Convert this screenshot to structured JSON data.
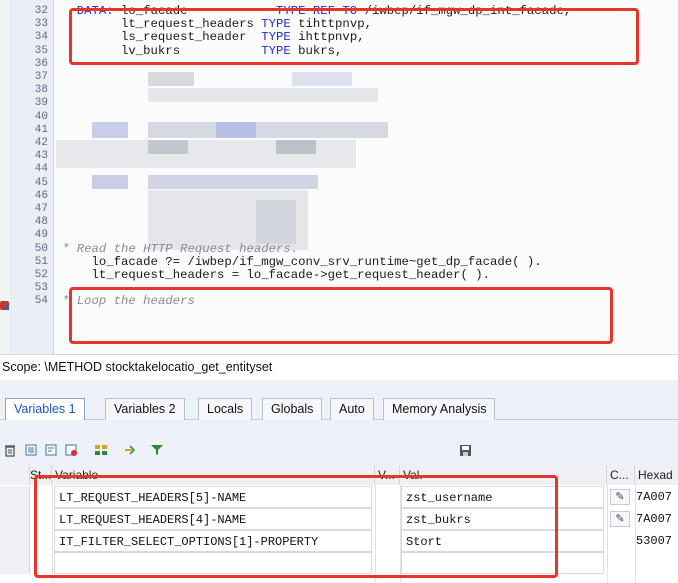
{
  "editor": {
    "line_numbers": [
      "32",
      "33",
      "34",
      "35",
      "36",
      "37",
      "38",
      "39",
      "40",
      "41",
      "42",
      "43",
      "44",
      "45",
      "46",
      "47",
      "48",
      "49",
      "50",
      "51",
      "52",
      "53",
      "54"
    ],
    "code_lines": [
      {
        "parts": [
          {
            "t": "  DATA: ",
            "c": "kw"
          },
          {
            "t": "lo_facade            ",
            "c": ""
          },
          {
            "t": "TYPE REF TO",
            "c": "kw"
          },
          {
            "t": " /iwbep/if_mgw_dp_int_facade,",
            "c": ""
          }
        ]
      },
      {
        "parts": [
          {
            "t": "        lt_request_headers ",
            "c": ""
          },
          {
            "t": "TYPE",
            "c": "kw"
          },
          {
            "t": " tihttpnvp,",
            "c": ""
          }
        ]
      },
      {
        "parts": [
          {
            "t": "        ls_request_header  ",
            "c": ""
          },
          {
            "t": "TYPE",
            "c": "kw"
          },
          {
            "t": " ihttpnvp,",
            "c": ""
          }
        ]
      },
      {
        "parts": [
          {
            "t": "        lv_bukrs           ",
            "c": ""
          },
          {
            "t": "TYPE",
            "c": "kw"
          },
          {
            "t": " bukrs,",
            "c": ""
          }
        ]
      },
      {
        "parts": [
          {
            "t": "* Read the HTTP Request headers.",
            "c": "cm"
          }
        ]
      },
      {
        "parts": [
          {
            "t": "    lo_facade ?= /iwbep/if_mgw_conv_srv_runtime~get_dp_facade( ).",
            "c": ""
          }
        ]
      },
      {
        "parts": [
          {
            "t": "    lt_request_headers = lo_facade->get_request_header( ).",
            "c": ""
          }
        ]
      },
      {
        "parts": [
          {
            "t": "* ",
            "c": "cm"
          },
          {
            "t": "Loop the headers",
            "c": "cm"
          }
        ]
      }
    ]
  },
  "scope": {
    "label": "Scope: \\METHOD stocktakelocatio_get_entityset"
  },
  "tabs": [
    {
      "label": "Variables 1",
      "active": true
    },
    {
      "label": "Variables 2",
      "active": false
    },
    {
      "label": "Locals",
      "active": false
    },
    {
      "label": "Globals",
      "active": false
    },
    {
      "label": "Auto",
      "active": false
    },
    {
      "label": "Memory Analysis",
      "active": false
    }
  ],
  "toolbar_icons": [
    "delete-icon",
    "expand-icon",
    "collapse-icon",
    "remove-row-icon",
    "grid-icon",
    "transfer-icon",
    "filter-icon",
    "save-icon"
  ],
  "grid": {
    "headers": {
      "status": "St...",
      "variable": "Variable",
      "v": "V...",
      "val": "Val.",
      "c": "C...",
      "hexa": "Hexad"
    },
    "rows": [
      {
        "variable": "LT_REQUEST_HEADERS[5]-NAME",
        "value": "zst_username",
        "editable": true,
        "hex": "7A007"
      },
      {
        "variable": "LT_REQUEST_HEADERS[4]-NAME",
        "value": "zst_bukrs",
        "editable": true,
        "hex": "7A007"
      },
      {
        "variable": "IT_FILTER_SELECT_OPTIONS[1]-PROPERTY",
        "value": "Stort",
        "editable": false,
        "hex": "53007"
      },
      {
        "variable": "",
        "value": "",
        "editable": false,
        "hex": ""
      }
    ]
  },
  "colors": {
    "highlight": "#e8352c",
    "keyword": "#1d2fc9",
    "active_tab": "#1a55c7"
  }
}
